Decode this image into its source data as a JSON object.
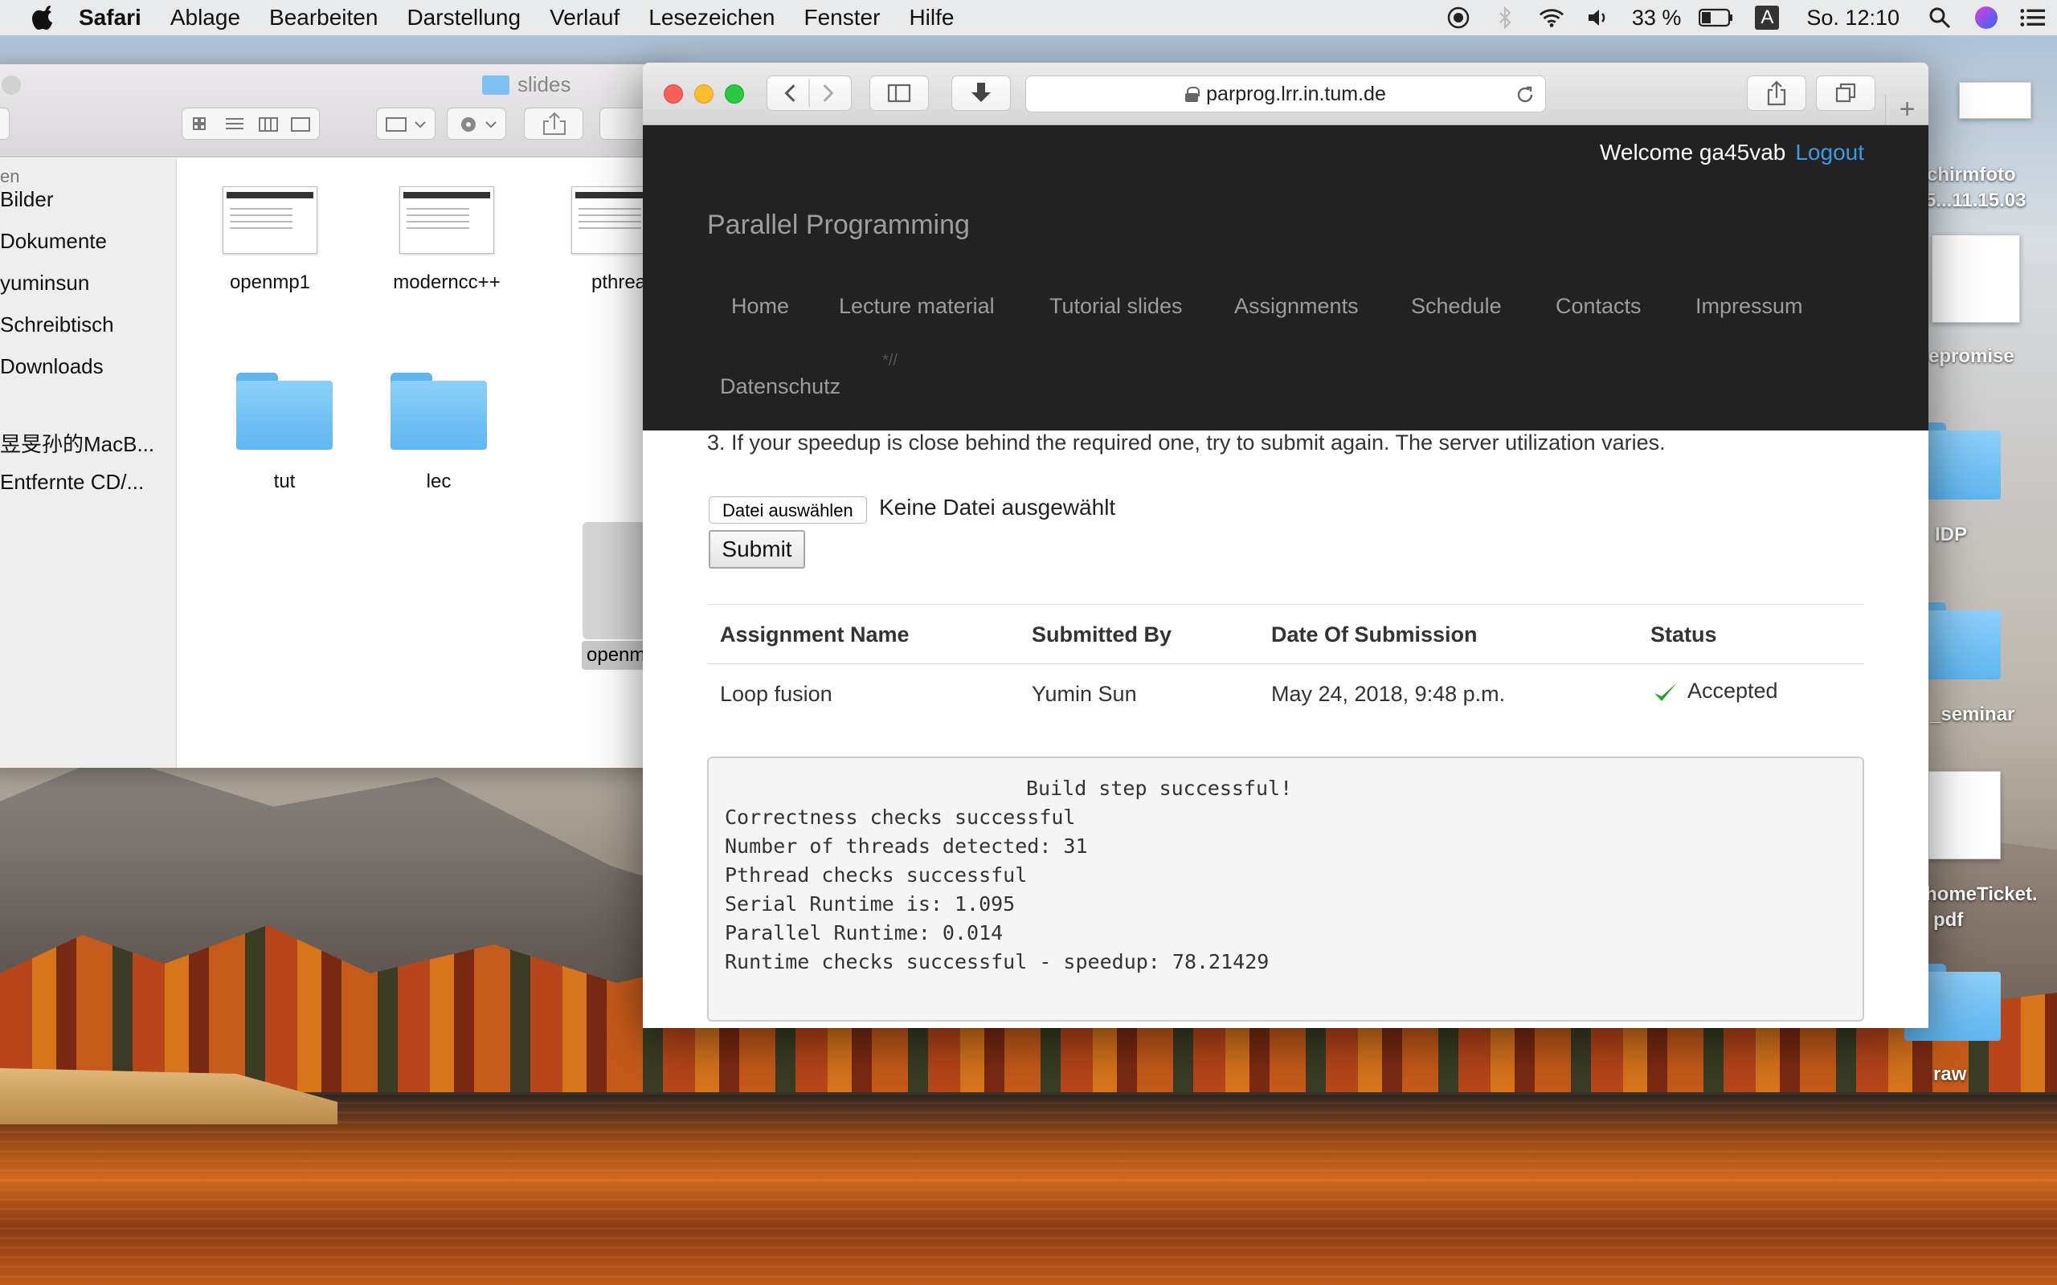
{
  "menubar": {
    "app_name": "Safari",
    "items": [
      "Ablage",
      "Bearbeiten",
      "Darstellung",
      "Verlauf",
      "Lesezeichen",
      "Fenster",
      "Hilfe"
    ],
    "battery": "33 %",
    "input_source": "A",
    "clock": "So. 12:10"
  },
  "finder": {
    "title": "slides",
    "sidebar_heading": "en",
    "sidebar_items": [
      "Bilder",
      "Dokumente",
      "yuminsun",
      "Schreibtisch",
      "Downloads",
      "昱旻孙的MacB...",
      "Entfernte CD/..."
    ],
    "files": [
      "openmp1",
      "moderncc++",
      "pthrea"
    ],
    "folders": [
      "tut",
      "lec"
    ],
    "selected_label": "openm"
  },
  "desktop": {
    "icons": [
      "chirmfoto",
      "5...11.15.03",
      "epromise",
      "IDP",
      "_seminar",
      "homeTicket.",
      "pdf",
      "raw"
    ]
  },
  "safari": {
    "url": "parprog.lrr.in.tum.de"
  },
  "site": {
    "brand": "Parallel Programming",
    "welcome": "Welcome ga45vab",
    "logout": "Logout",
    "nav": [
      "Home",
      "Lecture material",
      "Tutorial slides",
      "Assignments",
      "Schedule",
      "Contacts",
      "Impressum",
      "Datenschutz"
    ],
    "nav_stray_text": "*//"
  },
  "main": {
    "instruction": "3. If your speedup is close behind the required one, try to submit again. The server utilization varies.",
    "file_button": "Datei auswählen",
    "file_status": "Keine Datei ausgewählt",
    "submit": "Submit",
    "table": {
      "headers": [
        "Assignment Name",
        "Submitted By",
        "Date Of Submission",
        "Status"
      ],
      "rows": [
        {
          "name": "Loop fusion",
          "by": "Yumin Sun",
          "date": "May 24, 2018, 9:48 p.m.",
          "status": "Accepted"
        }
      ]
    },
    "log": [
      "Build step successful!",
      "Correctness checks successful",
      "Number of threads detected: 31",
      "Pthread checks successful",
      "Serial Runtime is: 1.095",
      "Parallel Runtime: 0.014",
      "Runtime checks successful - speedup: 78.21429"
    ]
  },
  "colors": {
    "navbar": "#222222",
    "link": "#3a9be0",
    "accepted_check": "#2e9d2e"
  }
}
